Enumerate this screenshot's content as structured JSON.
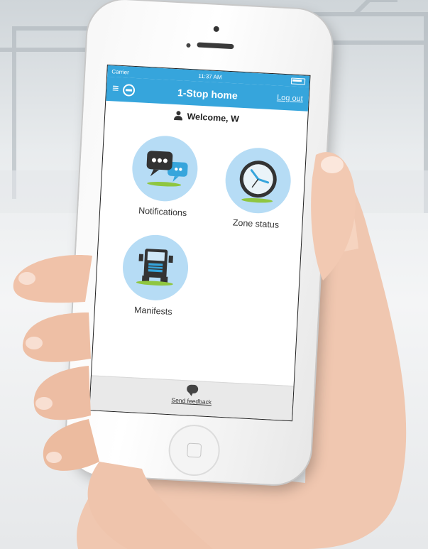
{
  "status_bar": {
    "carrier": "Carrier",
    "time": "11:37 AM"
  },
  "nav": {
    "title": "1-Stop home",
    "logout_label": "Log out"
  },
  "welcome": {
    "text": "Welcome, W"
  },
  "tiles": [
    {
      "label": "Notifications",
      "icon": "chat-bubbles-icon"
    },
    {
      "label": "Zone status",
      "icon": "clock-icon"
    },
    {
      "label": "Manifests",
      "icon": "truck-icon"
    }
  ],
  "footer": {
    "feedback_label": "Send feedback"
  },
  "colors": {
    "accent": "#36a5dc",
    "tile_circle": "#b6dcf5",
    "grass": "#8fc640"
  }
}
